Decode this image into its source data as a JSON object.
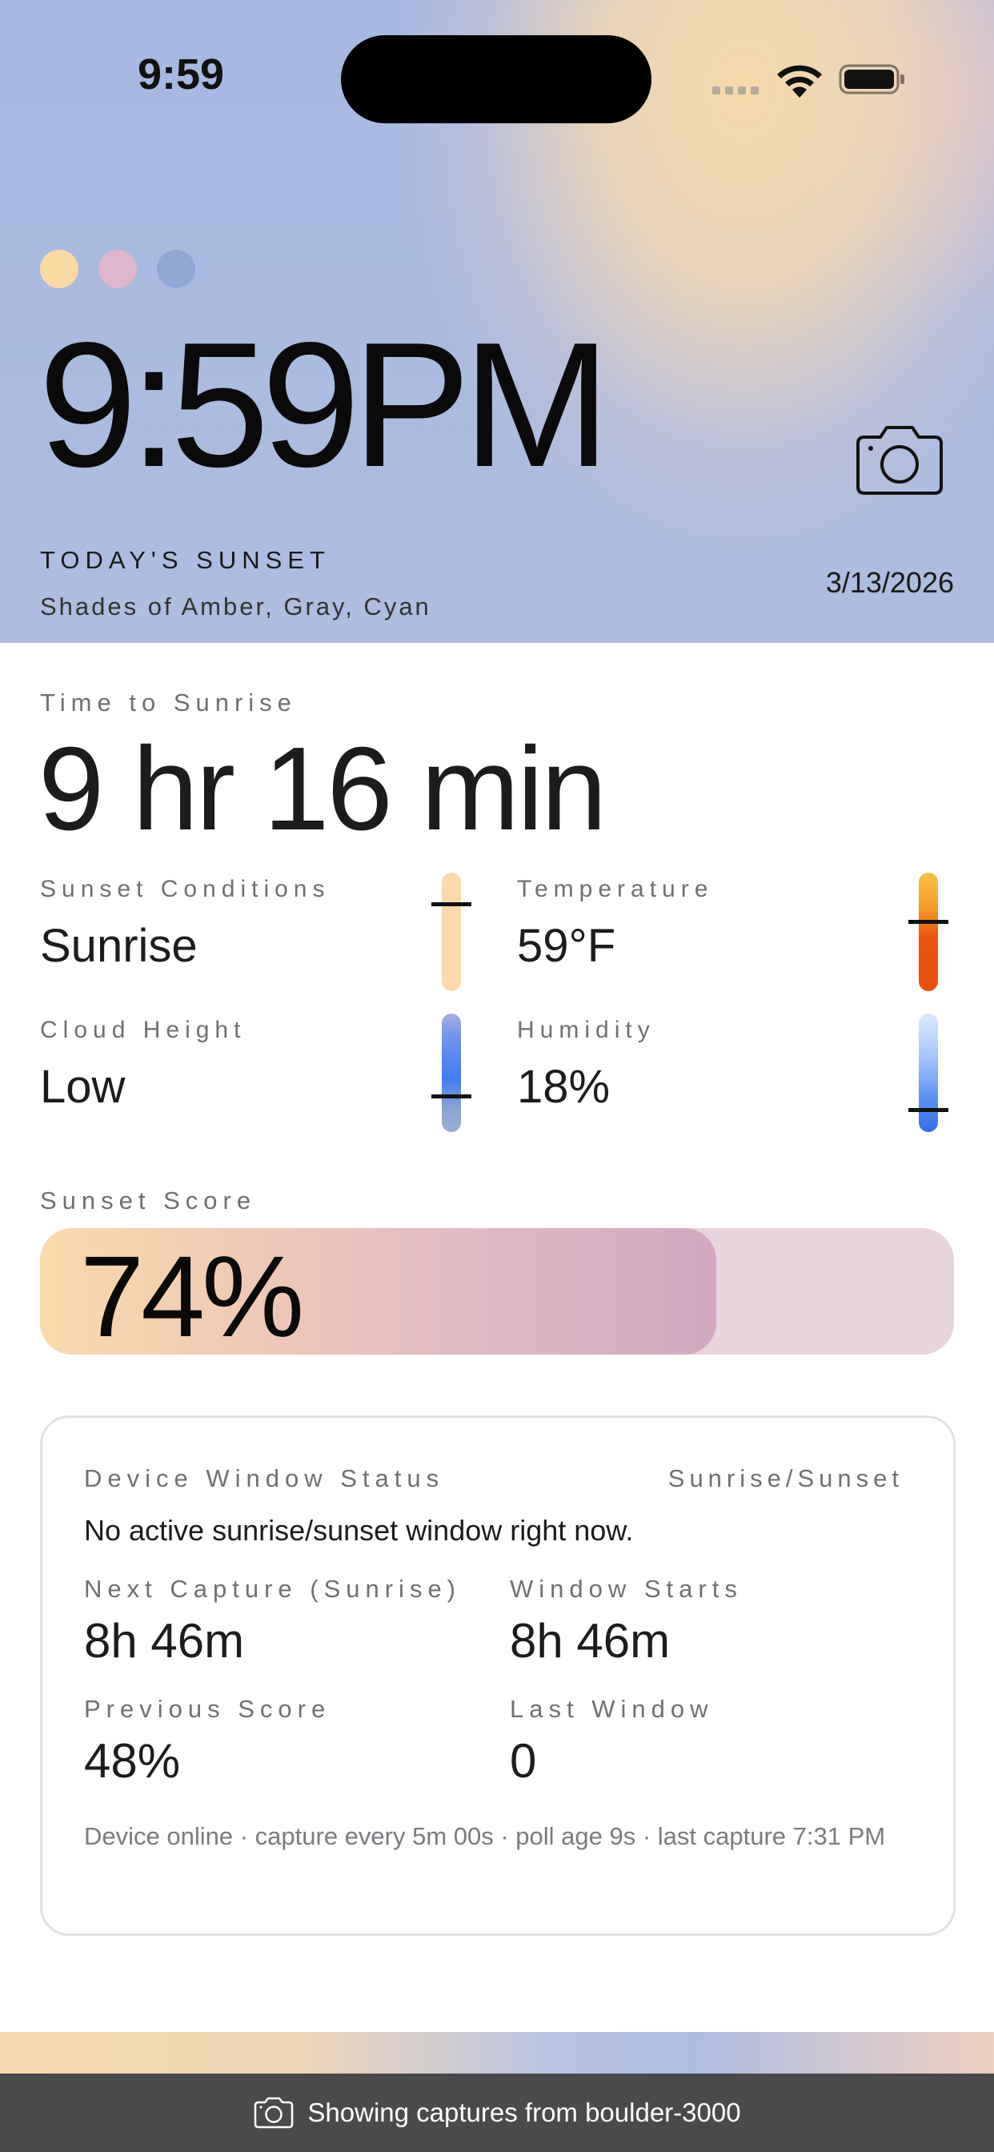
{
  "status_bar": {
    "time": "9:59"
  },
  "hero": {
    "dots": [
      {
        "name": "amber-dot",
        "color": "#fbd9a3"
      },
      {
        "name": "pink-dot",
        "color": "#dfb6cd"
      },
      {
        "name": "blue-dot",
        "color": "#90a8d6"
      }
    ],
    "time": "9:59PM",
    "label": "TODAY'S SUNSET",
    "shades": "Shades of Amber, Gray, Cyan",
    "date": "3/13/2026"
  },
  "time_to_sunrise": {
    "label": "Time to Sunrise",
    "value": "9 hr 16 min"
  },
  "metrics": {
    "conditions": {
      "label": "Sunset Conditions",
      "value": "Sunrise",
      "level": 0.75
    },
    "temperature": {
      "label": "Temperature",
      "value": "59°F",
      "level": 0.6
    },
    "cloud_height": {
      "label": "Cloud Height",
      "value": "Low",
      "level": 0.3
    },
    "humidity": {
      "label": "Humidity",
      "value": "18%",
      "level": 0.18
    }
  },
  "score": {
    "label": "Sunset Score",
    "value": "74%",
    "fraction": 0.74
  },
  "device": {
    "title": "Device Window Status",
    "mode": "Sunrise/Sunset",
    "message": "No active sunrise/sunset window right now.",
    "next_capture_label": "Next Capture (Sunrise)",
    "next_capture_value": "8h 46m",
    "window_starts_label": "Window Starts",
    "window_starts_value": "8h 46m",
    "previous_score_label": "Previous Score",
    "previous_score_value": "48%",
    "last_window_label": "Last Window",
    "last_window_value": "0",
    "footer": "Device online · capture every 5m 00s · poll age 9s · last capture 7:31 PM"
  },
  "bottom_bar": {
    "text": "Showing captures from boulder-3000",
    "icon": "camera-icon"
  },
  "colors": {
    "accent_amber": "#fbd9a3",
    "accent_pink": "#d3a8c0",
    "gauge_orange": "#e8540f",
    "gauge_blue": "#2f6fe8"
  }
}
